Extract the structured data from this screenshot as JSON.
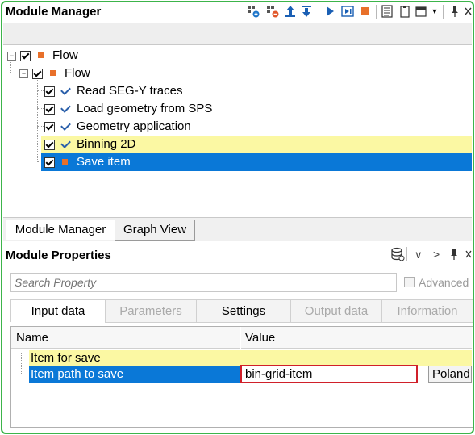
{
  "module_manager": {
    "title": "Module Manager",
    "toolbar_icons": [
      "add-module-icon",
      "remove-module-icon",
      "move-up-icon",
      "move-down-icon",
      "run-icon",
      "run-step-icon",
      "stop-icon",
      "list-icon",
      "clipboard-icon",
      "window-menu-icon",
      "pin-icon",
      "close-icon"
    ]
  },
  "tree": {
    "root": {
      "label": "Flow"
    },
    "flow": {
      "label": "Flow"
    },
    "items": [
      {
        "label": "Read SEG-Y traces"
      },
      {
        "label": "Load geometry from SPS"
      },
      {
        "label": "Geometry application"
      },
      {
        "label": "Binning 2D"
      },
      {
        "label": "Save item"
      }
    ]
  },
  "tabs": {
    "module_manager": "Module Manager",
    "graph_view": "Graph View"
  },
  "properties": {
    "title": "Module Properties",
    "search_placeholder": "Search Property",
    "advanced_label": "Advanced",
    "tabs": [
      "Input data",
      "Parameters",
      "Settings",
      "Output data",
      "Information"
    ],
    "columns": {
      "name": "Name",
      "value": "Value"
    },
    "rows": [
      {
        "name": "Item for save",
        "value": ""
      },
      {
        "name": "Item path to save",
        "value": "bin-grid-item",
        "extra": "Poland"
      }
    ]
  },
  "colors": {
    "frame_green": "#3cb44a",
    "selection_blue": "#0a78d7",
    "highlight_yellow": "#fbf8a3",
    "module_orange": "#e8702a",
    "value_outline_red": "#d0202a"
  }
}
